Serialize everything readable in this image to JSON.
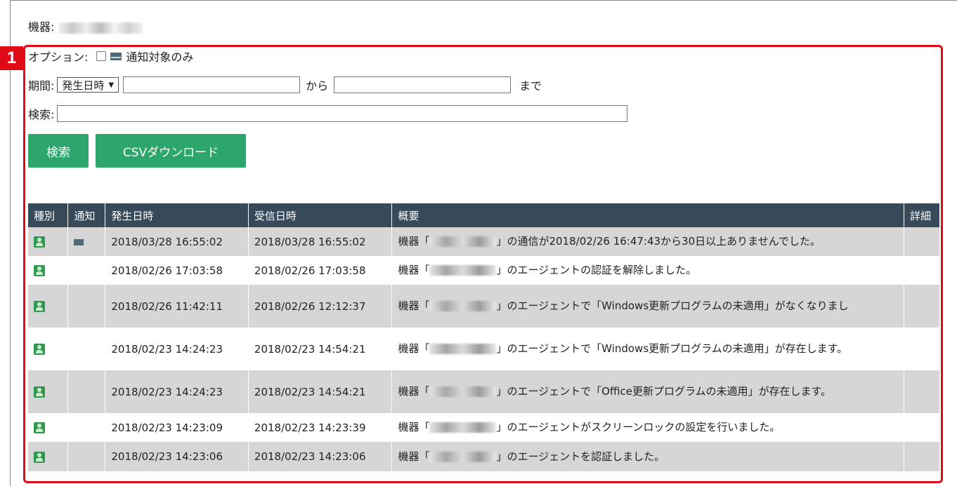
{
  "device": {
    "label": "機器:"
  },
  "callout_number": "1",
  "options": {
    "label": "オプション:",
    "checkbox_label": "通知対象のみ"
  },
  "period": {
    "label": "期間:",
    "select_value": "発生日時",
    "from_value": "",
    "from_text": "から",
    "to_value": "",
    "to_text": "まで"
  },
  "search": {
    "label": "検索:",
    "value": ""
  },
  "buttons": {
    "search": "検索",
    "csv": "CSVダウンロード"
  },
  "table": {
    "headers": [
      "種別",
      "通知",
      "発生日時",
      "受信日時",
      "概要",
      "詳細"
    ],
    "rows": [
      {
        "notify": true,
        "occurred": "2018/03/28 16:55:02",
        "received": "2018/03/28 16:55:02",
        "prefix": "機器「",
        "suffix": "」の通信が2018/02/26 16:47:43から30日以上ありませんでした。"
      },
      {
        "notify": false,
        "occurred": "2018/02/26 17:03:58",
        "received": "2018/02/26 17:03:58",
        "prefix": "機器「",
        "suffix": "」のエージェントの認証を解除しました。"
      },
      {
        "notify": false,
        "occurred": "2018/02/26 11:42:11",
        "received": "2018/02/26 12:12:37",
        "prefix": "機器「",
        "suffix": "」のエージェントで「Windows更新プログラムの未適用」がなくなりまし"
      },
      {
        "notify": false,
        "occurred": "2018/02/23 14:24:23",
        "received": "2018/02/23 14:54:21",
        "prefix": "機器「",
        "suffix": "」のエージェントで「Windows更新プログラムの未適用」が存在します。"
      },
      {
        "notify": false,
        "occurred": "2018/02/23 14:24:23",
        "received": "2018/02/23 14:54:21",
        "prefix": "機器「",
        "suffix": "」のエージェントで「Office更新プログラムの未適用」が存在します。"
      },
      {
        "notify": false,
        "occurred": "2018/02/23 14:23:09",
        "received": "2018/02/23 14:23:39",
        "prefix": "機器「",
        "suffix": "」のエージェントがスクリーンロックの設定を行いました。"
      },
      {
        "notify": false,
        "occurred": "2018/02/23 14:23:06",
        "received": "2018/02/23 14:23:06",
        "prefix": "機器「",
        "suffix": "」のエージェントを認証しました。"
      }
    ]
  },
  "colors": {
    "header_bg": "#364a5a",
    "button_bg": "#2da66b",
    "callout": "#e10a17",
    "row_alt": "#d6d6d6"
  }
}
